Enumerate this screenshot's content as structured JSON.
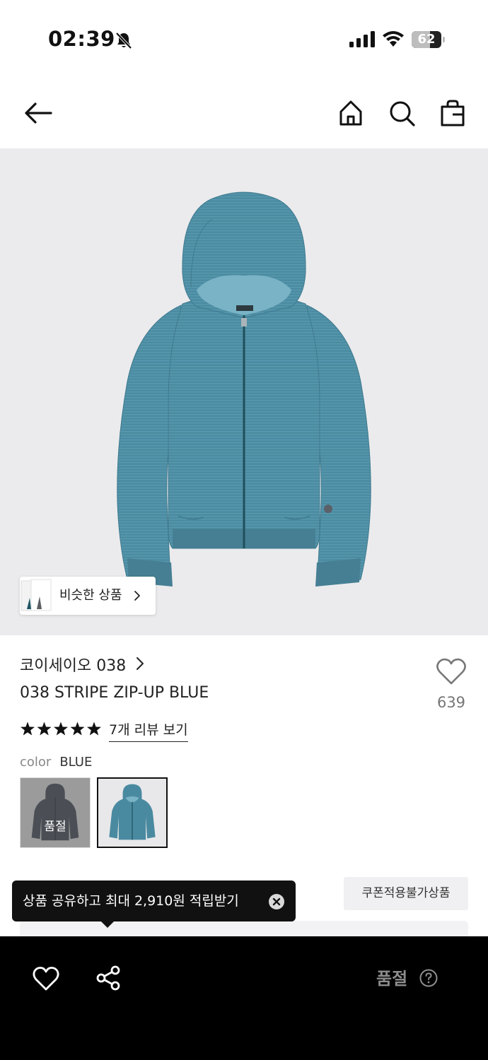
{
  "status_bar": {
    "time": "02:39",
    "battery_level": "62",
    "battery_fraction": 0.62
  },
  "nav": {
    "back_icon": "arrow-left-icon",
    "home_icon": "home-icon",
    "search_icon": "search-icon",
    "bag_icon": "shopping-bag-icon"
  },
  "product_image": {
    "background": "#ebebed",
    "garment_color": "#4a8aa0",
    "similar_products_label": "비슷한 상품"
  },
  "product": {
    "brand": "코이세이오 038",
    "name": "038 STRIPE ZIP-UP BLUE",
    "like_count": "639",
    "rating_stars": 5,
    "review_link": "7개 리뷰 보기",
    "color_label": "color",
    "color_value": "BLUE",
    "swatches": [
      {
        "color_name": "charcoal",
        "hex": "#4b4f55",
        "soldout_label": "품절",
        "selected": false
      },
      {
        "color_name": "blue",
        "hex": "#4a8aa0",
        "selected": true
      }
    ]
  },
  "share_tooltip": {
    "text": "상품 공유하고 최대 2,910원 적립받기",
    "close_icon": "close-circle-icon"
  },
  "coupon_badge": "쿠폰적용불가상품",
  "bottom_bar": {
    "like_icon": "heart-outline-icon",
    "share_icon": "share-icon",
    "soldout_label": "품절",
    "help_icon": "question-circle-icon"
  }
}
